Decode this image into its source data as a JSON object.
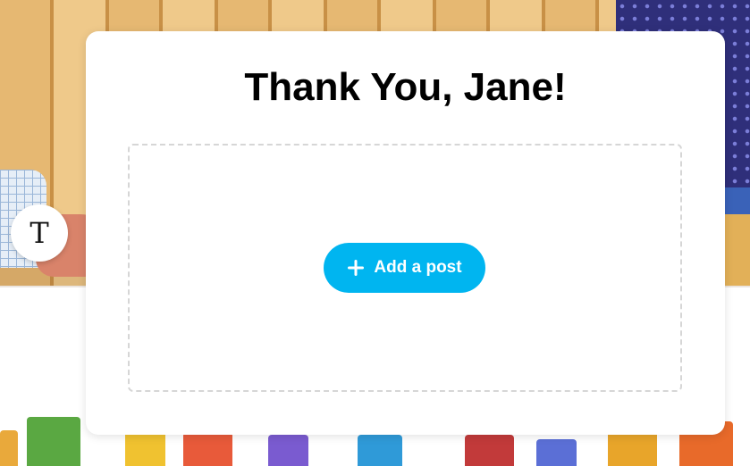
{
  "card": {
    "title": "Thank You, Jane!"
  },
  "avatar": {
    "initial": "T"
  },
  "post_area": {
    "add_button_label": "Add a post",
    "add_button_icon": "plus-icon"
  },
  "colors": {
    "accent": "#00b5f0",
    "card_bg": "#ffffff",
    "dropzone_border": "#d6d6d6",
    "title_text": "#000000"
  }
}
